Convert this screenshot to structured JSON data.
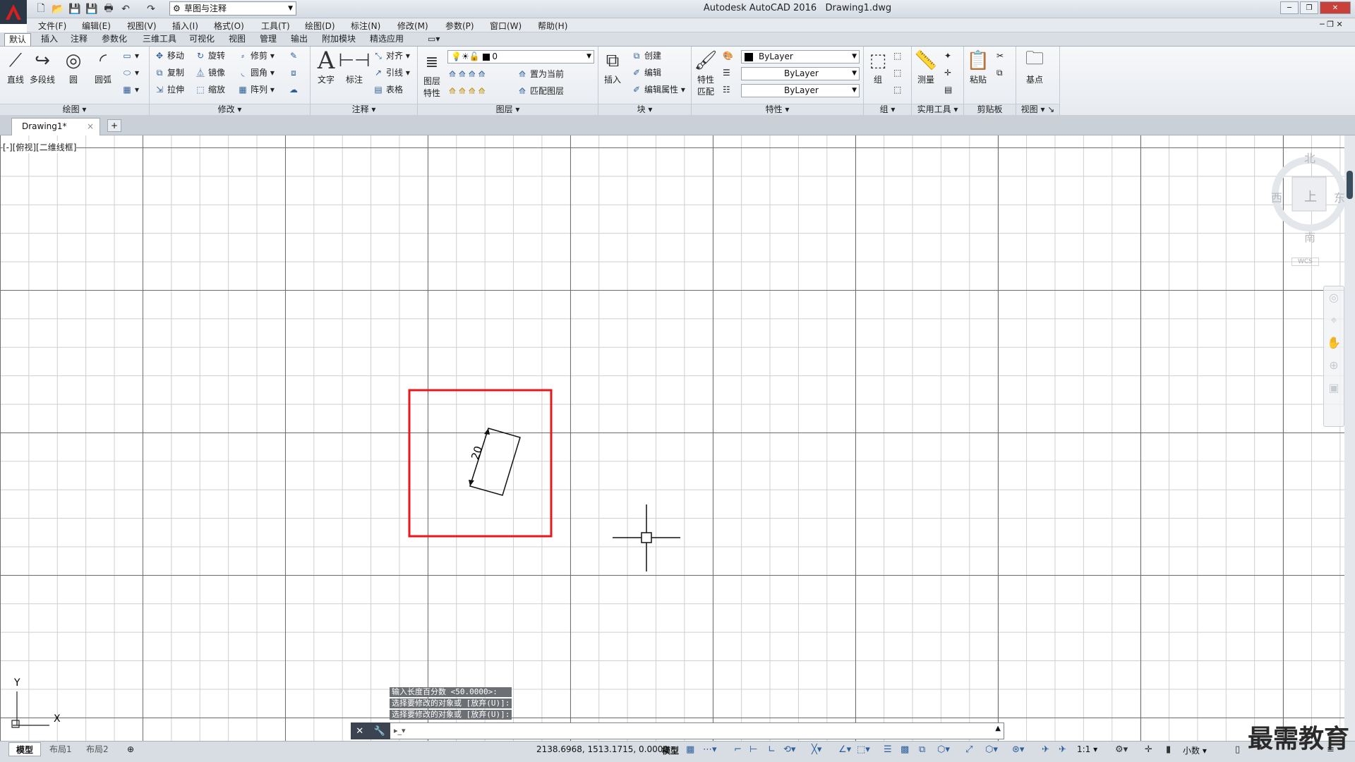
{
  "app": {
    "title": "Autodesk AutoCAD 2016",
    "document": "Drawing1.dwg",
    "workspace": "草图与注释",
    "logo_letter": "A"
  },
  "menus": [
    "文件(F)",
    "编辑(E)",
    "视图(V)",
    "插入(I)",
    "格式(O)",
    "工具(T)",
    "绘图(D)",
    "标注(N)",
    "修改(M)",
    "参数(P)",
    "窗口(W)",
    "帮助(H)"
  ],
  "ribbon_tabs": [
    "默认",
    "插入",
    "注释",
    "参数化",
    "三维工具",
    "可视化",
    "视图",
    "管理",
    "输出",
    "附加模块",
    "精选应用"
  ],
  "ribbon": {
    "draw": {
      "title": "绘图",
      "line": "直线",
      "polyline": "多段线",
      "circle": "圆",
      "arc": "圆弧"
    },
    "modify": {
      "title": "修改",
      "move": "移动",
      "rotate": "旋转",
      "trim": "修剪",
      "copy": "复制",
      "mirror": "镜像",
      "fillet": "圆角",
      "stretch": "拉伸",
      "scale": "缩放",
      "array": "阵列"
    },
    "annotation": {
      "title": "注释",
      "text": "文字",
      "dimension": "标注",
      "align": "对齐",
      "leader": "引线",
      "table": "表格"
    },
    "layers": {
      "title": "图层",
      "properties_line1": "图层",
      "properties_line2": "特性",
      "current_layer": "0",
      "set_current": "置为当前",
      "match_layer": "匹配图层"
    },
    "block": {
      "title": "块",
      "insert": "插入",
      "create": "创建",
      "edit": "编辑",
      "edit_attributes": "编辑属性"
    },
    "properties": {
      "title": "特性",
      "match_line1": "特性",
      "match_line2": "匹配",
      "color": "ByLayer",
      "linetype": "ByLayer",
      "lineweight": "ByLayer"
    },
    "groups": {
      "title": "组",
      "group": "组"
    },
    "utilities": {
      "title": "实用工具",
      "measure": "测量"
    },
    "clipboard": {
      "title": "剪贴板",
      "paste": "粘贴"
    },
    "view": {
      "title": "视图",
      "base": "基点"
    }
  },
  "doc_tab": {
    "name": "Drawing1*",
    "close": "×",
    "add": "+"
  },
  "viewport_label": "[-][俯视][二维线框]",
  "viewcube": {
    "north": "北",
    "south": "南",
    "east": "东",
    "west": "西",
    "face": "上",
    "wcs": "WCS"
  },
  "drawing": {
    "dimension_text": "20"
  },
  "ucs": {
    "x": "X",
    "y": "Y"
  },
  "command_history": [
    "输入长度百分数 <50.0000>:",
    "选择要修改的对象或 [放弃(U)]:",
    "选择要修改的对象或 [放弃(U)]:"
  ],
  "command_prompt": "",
  "layout_tabs": [
    "模型",
    "布局1",
    "布局2"
  ],
  "status": {
    "coordinates": "2138.6968, 1513.1715, 0.0000",
    "space": "模型",
    "scale": "1:1",
    "units": "小数"
  },
  "watermark": "最需教育",
  "colors": {
    "highlight_box": "#e8171b",
    "grid_major": "#6e6e6e",
    "grid_minor": "#cfcfcf",
    "logo_red": "#d42020"
  }
}
